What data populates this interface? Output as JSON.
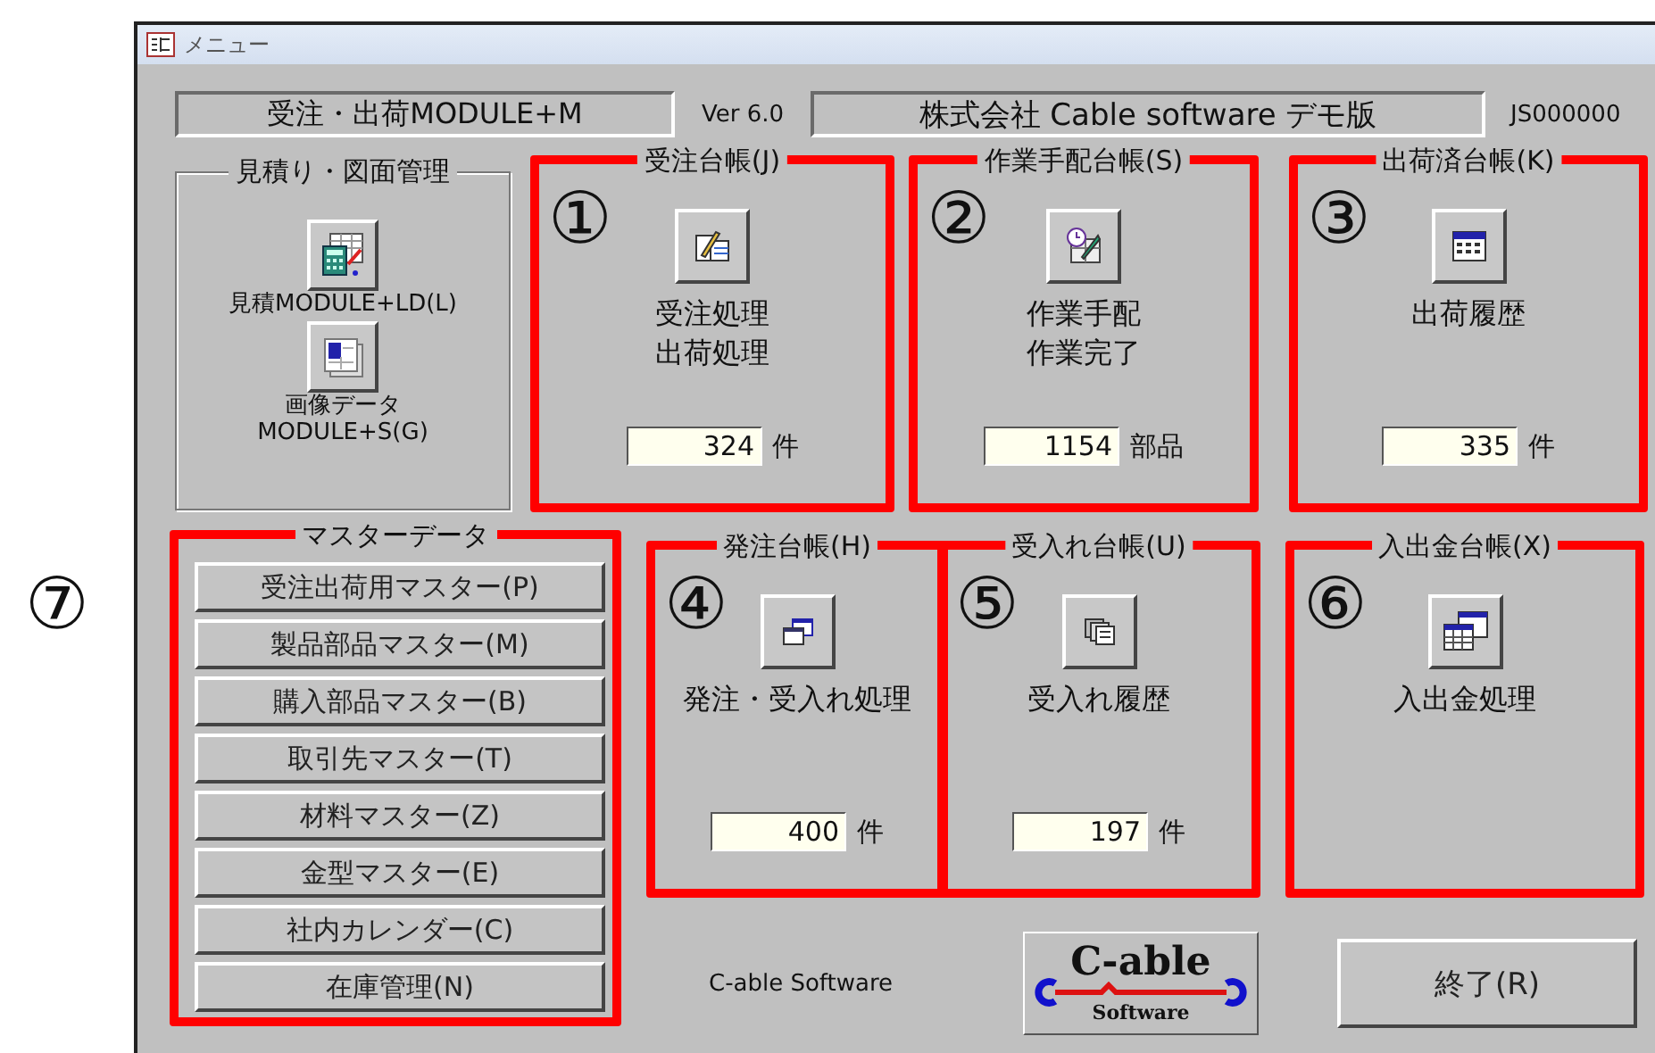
{
  "window": {
    "title": "メニュー"
  },
  "header": {
    "product": "受注・出荷MODULE+M",
    "version": "Ver 6.0",
    "company": "株式会社  Cable software デモ版",
    "code": "JS000000"
  },
  "estimate_group": {
    "title": "見積り・図面管理",
    "buttons": [
      {
        "lines": [
          "見積MODULE+LD(L)"
        ]
      },
      {
        "lines": [
          "画像データ",
          "MODULE+S(G)"
        ]
      }
    ]
  },
  "ledgers": [
    {
      "title": "受注台帳(J)",
      "marker": "①",
      "highlighted": true,
      "lines": [
        "受注処理",
        "出荷処理"
      ],
      "count": "324",
      "unit": "件"
    },
    {
      "title": "作業手配台帳(S)",
      "marker": "②",
      "highlighted": true,
      "lines": [
        "作業手配",
        "作業完了"
      ],
      "count": "1154",
      "unit": "部品"
    },
    {
      "title": "出荷済台帳(K)",
      "marker": "③",
      "highlighted": true,
      "lines": [
        "出荷履歴"
      ],
      "count": "335",
      "unit": "件"
    },
    {
      "title": "発注台帳(H)",
      "marker": "④",
      "highlighted": true,
      "lines": [
        "発注・受入れ処理"
      ],
      "count": "400",
      "unit": "件"
    },
    {
      "title": "受入れ台帳(U)",
      "marker": "⑤",
      "highlighted": true,
      "lines": [
        "受入れ履歴"
      ],
      "count": "197",
      "unit": "件"
    },
    {
      "title": "入出金台帳(X)",
      "marker": "⑥",
      "highlighted": true,
      "lines": [
        "入出金処理"
      ]
    }
  ],
  "master_group": {
    "title": "マスターデータ",
    "marker": "⑦",
    "highlighted": true,
    "buttons": [
      "受注出荷用マスター(P)",
      "製品部品マスター(M)",
      "購入部品マスター(B)",
      "取引先マスター(T)",
      "材料マスター(Z)",
      "金型マスター(E)",
      "社内カレンダー(C)",
      "在庫管理(N)"
    ]
  },
  "footer": {
    "company_text": "C-able Software",
    "logo": {
      "title": "C-able",
      "subtitle": "Software"
    },
    "exit_button": "終了(R)"
  }
}
